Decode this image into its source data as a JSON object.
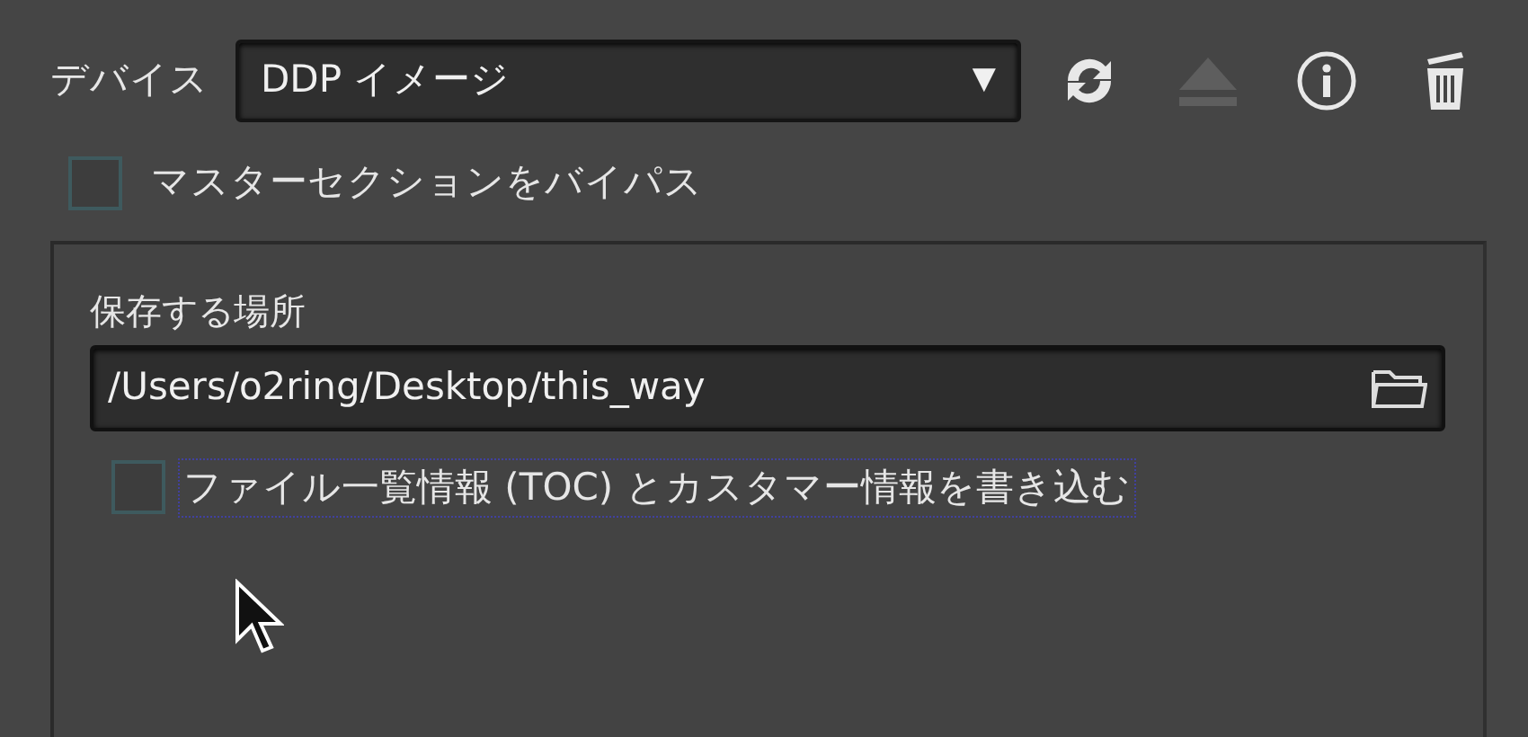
{
  "device": {
    "label": "デバイス",
    "value": "DDP イメージ",
    "arrow": "▼"
  },
  "toolbar": [
    {
      "kind": "refresh",
      "disabled": false
    },
    {
      "kind": "eject",
      "disabled": true
    },
    {
      "kind": "info",
      "disabled": false
    },
    {
      "kind": "trash",
      "disabled": false
    }
  ],
  "bypass": {
    "label": "マスターセクションをバイパス",
    "checked": false
  },
  "save_location": {
    "label": "保存する場所",
    "value": "/Users/o2ring/Desktop/this_way",
    "write_toc": {
      "label": "ファイル一覧情報 (TOC) とカスタマー情報を書き込む",
      "checked": false,
      "focused": true
    }
  }
}
